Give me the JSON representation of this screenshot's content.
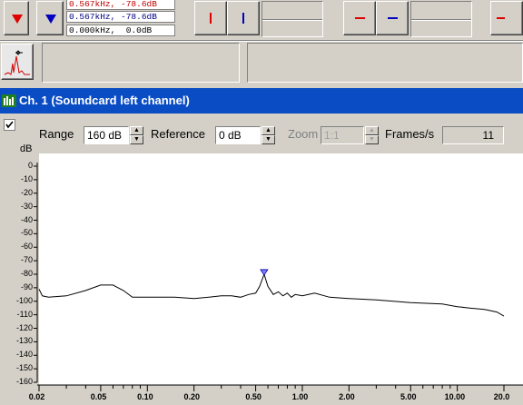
{
  "toolbar": {
    "marker_down_icon": "red-down-triangle",
    "marker_select_icon": "blue-down-triangle",
    "readouts": [
      "0.567kHz, -78.6dB",
      "0.567kHz, -78.6dB",
      "0.000kHz,  0.0dB"
    ],
    "readout_colors": [
      "#c00000",
      "#000080",
      "#000000"
    ]
  },
  "window": {
    "title": "Ch. 1 (Soundcard left channel)"
  },
  "controls": {
    "checkbox_checked": true,
    "range_label": "Range",
    "range_value": "160 dB",
    "reference_label": "Reference",
    "reference_value": "0 dB",
    "zoom_label": "Zoom",
    "zoom_value": "1:1",
    "frames_label": "Frames/s",
    "frames_value": "11"
  },
  "chart_data": {
    "type": "line",
    "ylabel": "dB",
    "xscale": "log",
    "ylim": [
      -160,
      0
    ],
    "xlim": [
      0.02,
      20.0
    ],
    "y_ticks": [
      "0",
      "-10",
      "-20",
      "-30",
      "-40",
      "-50",
      "-60",
      "-70",
      "-80",
      "-90",
      "-100",
      "-110",
      "-120",
      "-130",
      "-140",
      "-150",
      "-160"
    ],
    "x_ticks": [
      "0.02",
      "0.05",
      "0.10",
      "0.20",
      "0.50",
      "1.00",
      "2.00",
      "5.00",
      "10.00",
      "20.0"
    ],
    "marker": {
      "x": 0.567,
      "y": -78.6
    },
    "series": [
      {
        "x": [
          0.02,
          0.021,
          0.023,
          0.03,
          0.04,
          0.05,
          0.06,
          0.07,
          0.08,
          0.1,
          0.15,
          0.2,
          0.25,
          0.3,
          0.35,
          0.4,
          0.45,
          0.5,
          0.53,
          0.567,
          0.6,
          0.65,
          0.7,
          0.75,
          0.8,
          0.85,
          0.9,
          1.0,
          1.2,
          1.5,
          2.0,
          3.0,
          5.0,
          8.0,
          10.0,
          12.0,
          15.0,
          18.0,
          20.0
        ],
        "y": [
          -91,
          -96,
          -97,
          -96,
          -92,
          -88,
          -88,
          -92,
          -97,
          -97,
          -97,
          -98,
          -97,
          -96,
          -96,
          -97,
          -95,
          -94,
          -89,
          -80,
          -89,
          -95,
          -93,
          -96,
          -94,
          -97,
          -95,
          -96,
          -94,
          -97,
          -98,
          -99,
          -101,
          -102,
          -104,
          -105,
          -106,
          -108,
          -111
        ]
      }
    ]
  }
}
